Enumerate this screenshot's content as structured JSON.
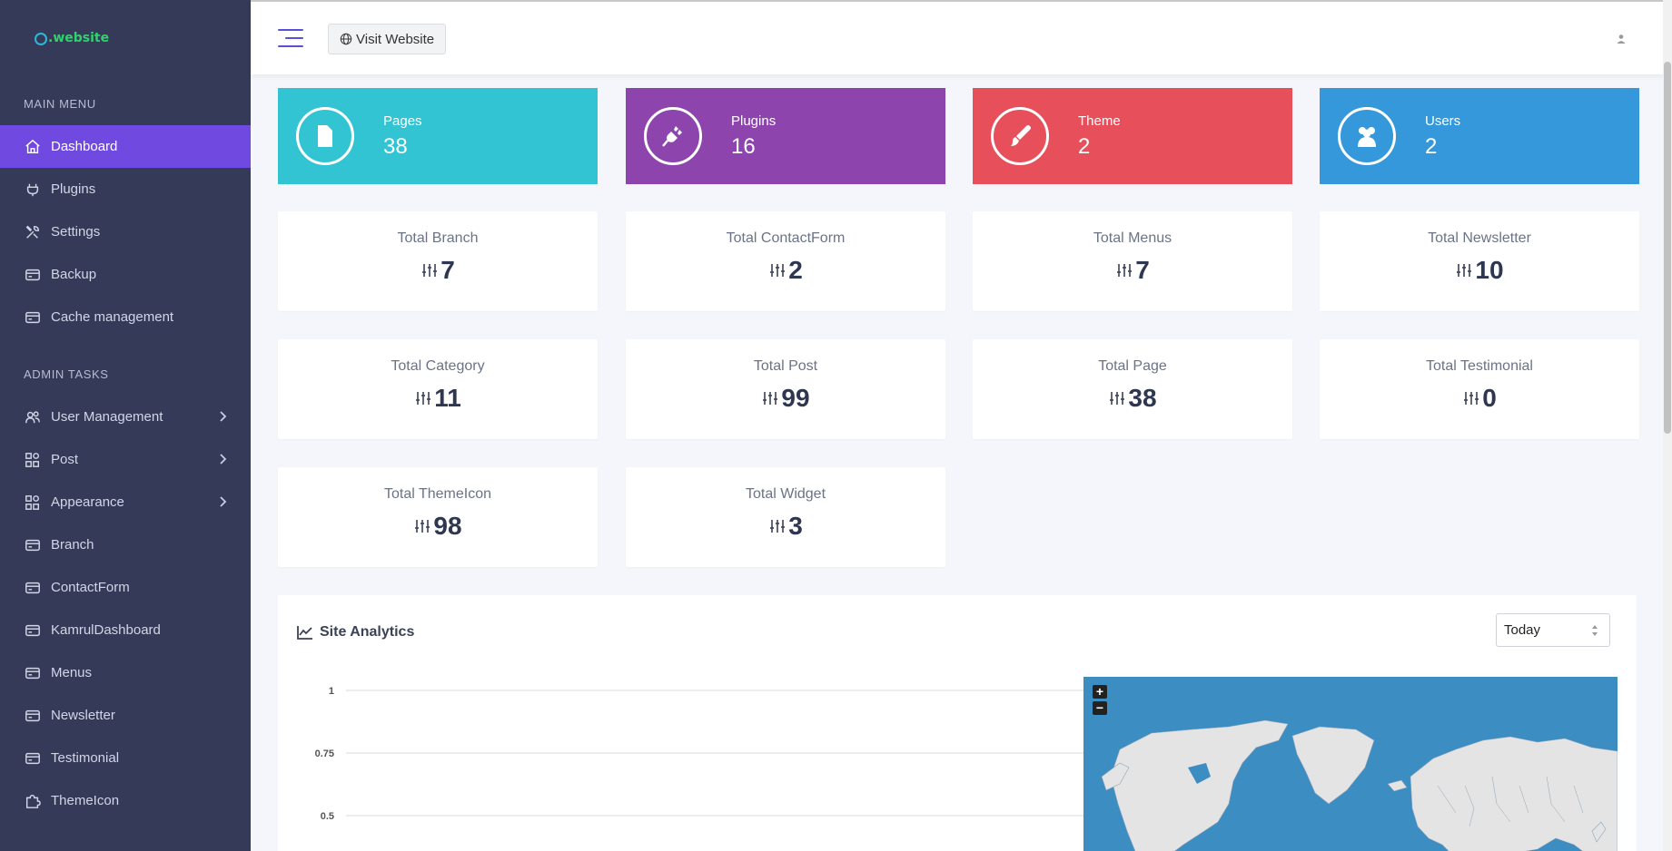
{
  "brand": {
    "text": ".website"
  },
  "sidebar": {
    "main_menu_label": "MAIN MENU",
    "main_items": [
      {
        "label": "Dashboard",
        "icon": "home-icon"
      },
      {
        "label": "Plugins",
        "icon": "plug-icon"
      },
      {
        "label": "Settings",
        "icon": "tools-icon"
      },
      {
        "label": "Backup",
        "icon": "card-icon"
      },
      {
        "label": "Cache management",
        "icon": "card-icon"
      }
    ],
    "admin_tasks_label": "ADMIN TASKS",
    "admin_items": [
      {
        "label": "User Management",
        "icon": "users-icon"
      },
      {
        "label": "Post",
        "icon": "grid-icon"
      },
      {
        "label": "Appearance",
        "icon": "grid-icon"
      },
      {
        "label": "Branch",
        "icon": "card-icon"
      },
      {
        "label": "ContactForm",
        "icon": "card-icon"
      },
      {
        "label": "KamrulDashboard",
        "icon": "card-icon"
      },
      {
        "label": "Menus",
        "icon": "card-icon"
      },
      {
        "label": "Newsletter",
        "icon": "card-icon"
      },
      {
        "label": "Testimonial",
        "icon": "card-icon"
      },
      {
        "label": "ThemeIcon",
        "icon": "puzzle-icon"
      }
    ]
  },
  "topbar": {
    "visit_label": "Visit Website"
  },
  "stats": [
    {
      "label": "Pages",
      "value": "38",
      "color": "#33c4d3",
      "icon": "file-icon"
    },
    {
      "label": "Plugins",
      "value": "16",
      "color": "#8e44ad",
      "icon": "plug-icon"
    },
    {
      "label": "Theme",
      "value": "2",
      "color": "#e74f5a",
      "icon": "brush-icon"
    },
    {
      "label": "Users",
      "value": "2",
      "color": "#3498db",
      "icon": "users-icon"
    }
  ],
  "totals": [
    {
      "label": "Total Branch",
      "value": "7"
    },
    {
      "label": "Total ContactForm",
      "value": "2"
    },
    {
      "label": "Total Menus",
      "value": "7"
    },
    {
      "label": "Total Newsletter",
      "value": "10"
    },
    {
      "label": "Total Category",
      "value": "11"
    },
    {
      "label": "Total Post",
      "value": "99"
    },
    {
      "label": "Total Page",
      "value": "38"
    },
    {
      "label": "Total Testimonial",
      "value": "0"
    },
    {
      "label": "Total ThemeIcon",
      "value": "98"
    },
    {
      "label": "Total Widget",
      "value": "3"
    }
  ],
  "analytics": {
    "title": "Site Analytics",
    "range_value": "Today",
    "map_zoom_in": "+",
    "map_zoom_out": "−"
  },
  "chart_data": {
    "type": "line",
    "yticks": [
      "1",
      "0.75",
      "0.5"
    ],
    "ylim": [
      0.5,
      1
    ],
    "series": []
  }
}
